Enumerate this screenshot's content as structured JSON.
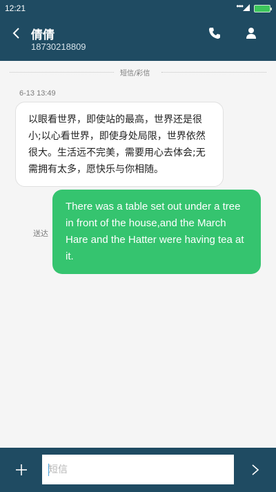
{
  "status_bar": {
    "time": "12:21",
    "dots": "•••",
    "battery_color": "#3cc65b"
  },
  "header": {
    "contact_name": "倩倩",
    "phone_number": "18730218809",
    "back_icon": "chevron-left-icon",
    "call_icon": "phone-icon",
    "contact_icon": "person-icon",
    "background_color": "#1f4b62"
  },
  "conversation": {
    "divider_label": "短信/彩信",
    "timestamp": "6-13 13:49",
    "incoming_message": "以眼看世界，即使站的最高，世界还是很小;以心看世界，即使身处局限，世界依然很大。生活远不完美，需要用心去体会;无需拥有太多，愿快乐与你相随。",
    "outgoing_message": "There was a table set out under a tree in front of the house,and the March Hare and the Hatter were having tea at it.",
    "outgoing_status": "送达",
    "outgoing_bubble_color": "#35c46f"
  },
  "composer": {
    "placeholder": "短信",
    "value": "",
    "add_icon": "plus-icon",
    "send_icon": "chevron-right-icon"
  }
}
